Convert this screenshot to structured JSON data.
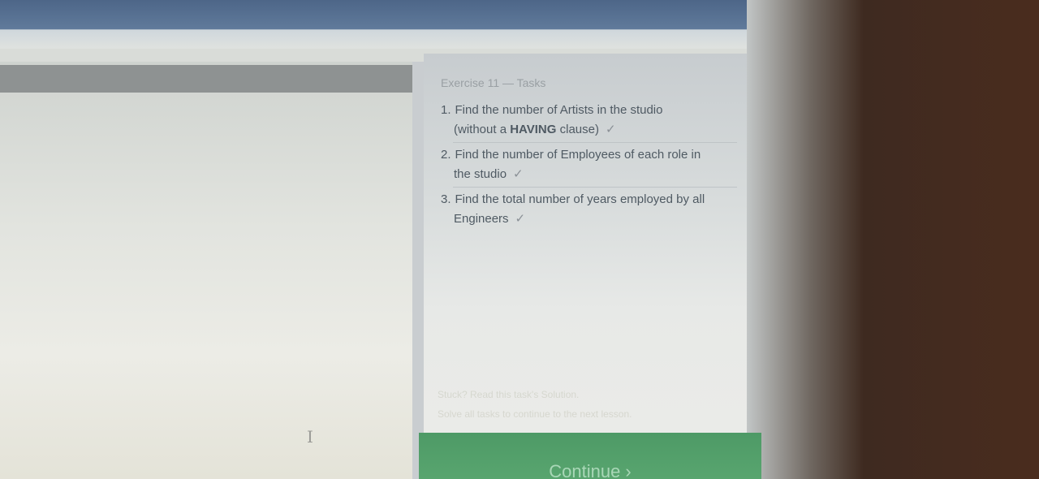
{
  "panel": {
    "title": "Exercise 11 — Tasks",
    "tasks": [
      {
        "number": "1.",
        "line1": "Find the number of Artists in the studio",
        "line2_pre": "(without a ",
        "line2_bold": "HAVING",
        "line2_post": " clause)",
        "check": "✓"
      },
      {
        "number": "2.",
        "line1": "Find the number of Employees of each role in",
        "line2": "the studio",
        "check": "✓"
      },
      {
        "number": "3.",
        "line1": "Find the total number of years employed by all",
        "line2": "Engineers",
        "check": "✓"
      }
    ],
    "hint": "Stuck? Read this task's Solution.",
    "note": "Solve all tasks to continue to the next lesson.",
    "continue_label": "Continue ›"
  },
  "left": {
    "cursor": "I"
  }
}
